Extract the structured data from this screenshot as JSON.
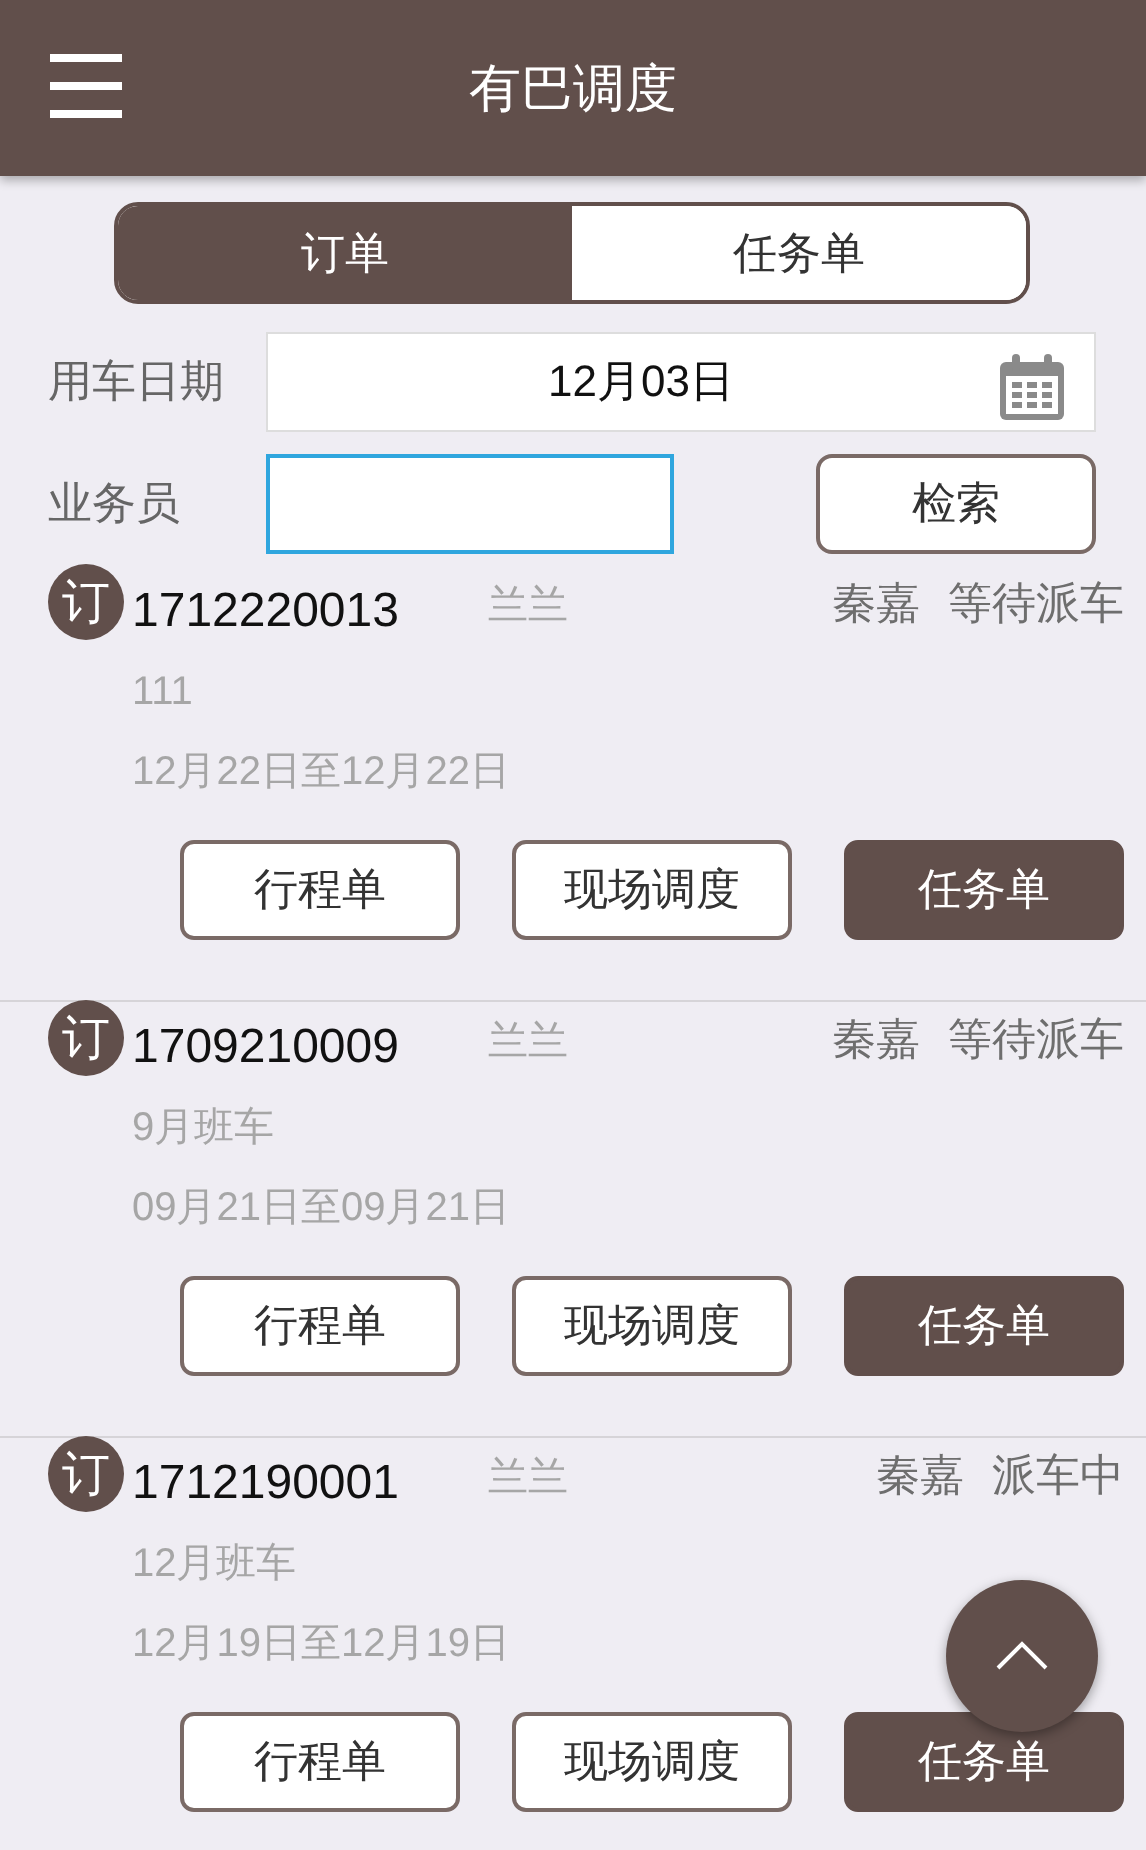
{
  "header": {
    "title": "有巴调度"
  },
  "tabs": [
    {
      "label": "订单",
      "selected": true
    },
    {
      "label": "任务单",
      "selected": false
    }
  ],
  "filters": {
    "date_label": "用车日期",
    "date_value": "12月03日",
    "staff_label": "业务员",
    "staff_focused": true,
    "search_button": "检索"
  },
  "orders": [
    {
      "badge": "订",
      "number": "1712220013",
      "contact": "兰兰",
      "driver": "秦嘉",
      "status": "等待派车",
      "note": "111",
      "date_range": "12月22日至12月22日",
      "buttons": [
        {
          "label": "行程单",
          "kind": "outline"
        },
        {
          "label": "现场调度",
          "kind": "outline"
        },
        {
          "label": "任务单",
          "kind": "filled"
        }
      ]
    },
    {
      "badge": "订",
      "number": "1709210009",
      "contact": "兰兰",
      "driver": "秦嘉",
      "status": "等待派车",
      "note": "9月班车",
      "date_range": "09月21日至09月21日",
      "buttons": [
        {
          "label": "行程单",
          "kind": "outline"
        },
        {
          "label": "现场调度",
          "kind": "outline"
        },
        {
          "label": "任务单",
          "kind": "filled"
        }
      ]
    },
    {
      "badge": "订",
      "number": "1712190001",
      "contact": "兰兰",
      "driver": "秦嘉",
      "status": "派车中",
      "note": "12月班车",
      "date_range": "12月19日至12月19日",
      "buttons": [
        {
          "label": "行程单",
          "kind": "outline"
        },
        {
          "label": "现场调度",
          "kind": "outline"
        },
        {
          "label": "任务单",
          "kind": "filled"
        }
      ]
    }
  ]
}
